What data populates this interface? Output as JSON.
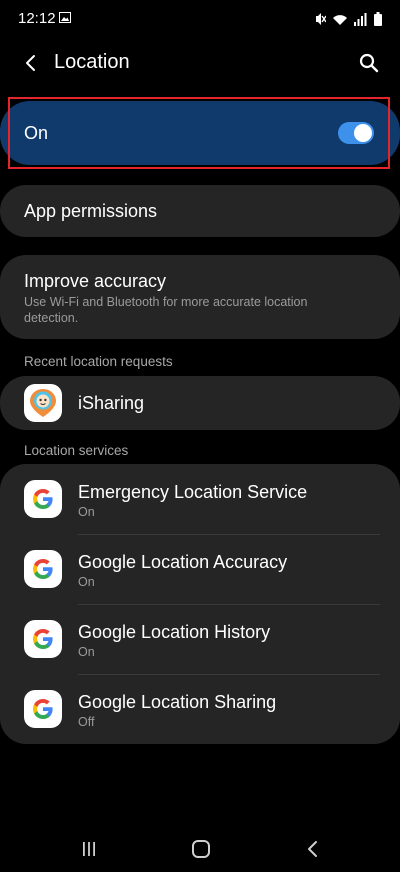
{
  "status_bar": {
    "time": "12:12",
    "icons": [
      "image-icon",
      "mute-icon",
      "wifi-icon",
      "signal-icon",
      "battery-icon"
    ]
  },
  "header": {
    "title": "Location",
    "back_icon": "chevron-left-icon",
    "search_icon": "search-icon"
  },
  "master_switch": {
    "label": "On",
    "state": "on",
    "accent": "#3e91ea",
    "highlight_color": "#e2262b"
  },
  "settings": {
    "app_permissions": {
      "title": "App permissions"
    },
    "improve_accuracy": {
      "title": "Improve accuracy",
      "description": "Use Wi-Fi and Bluetooth for more accurate location detection."
    }
  },
  "recent_requests": {
    "header": "Recent location requests",
    "items": [
      {
        "name": "iSharing",
        "icon": "isharing-app-icon"
      }
    ]
  },
  "location_services": {
    "header": "Location services",
    "items": [
      {
        "name": "Emergency Location Service",
        "status": "On",
        "icon": "google-g-icon"
      },
      {
        "name": "Google Location Accuracy",
        "status": "On",
        "icon": "google-g-icon"
      },
      {
        "name": "Google Location History",
        "status": "On",
        "icon": "google-g-icon"
      },
      {
        "name": "Google Location Sharing",
        "status": "Off",
        "icon": "google-g-icon"
      }
    ]
  },
  "nav_bar": {
    "buttons": [
      "recent-apps-icon",
      "home-icon",
      "back-icon"
    ]
  }
}
